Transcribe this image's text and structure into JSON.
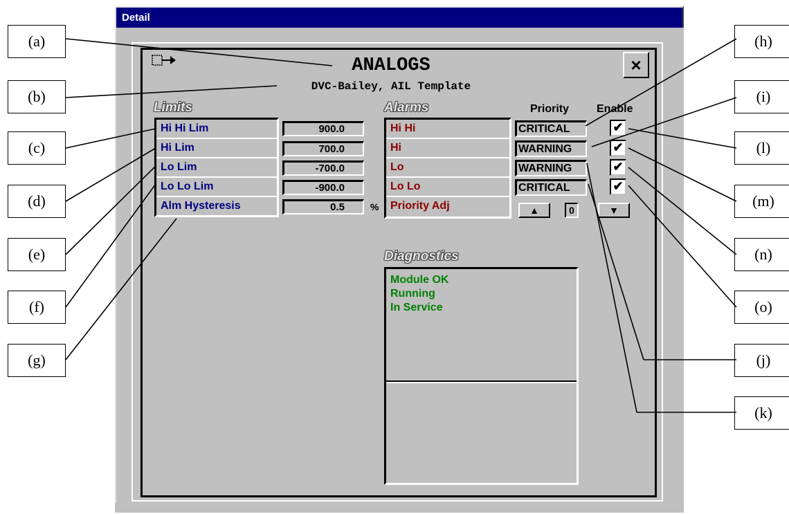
{
  "window": {
    "title": "Detail"
  },
  "header": {
    "title": "ANALOGS",
    "subtitle": "DVC-Bailey, AIL Template",
    "menu_icon": "menu-arrow-icon",
    "close_glyph": "×"
  },
  "limits": {
    "heading": "Limits",
    "rows": [
      {
        "label": "Hi Hi Lim",
        "value": "900.0"
      },
      {
        "label": "Hi Lim",
        "value": "700.0"
      },
      {
        "label": "Lo Lim",
        "value": "-700.0"
      },
      {
        "label": "Lo Lo Lim",
        "value": "-900.0"
      },
      {
        "label": "Alm Hysteresis",
        "value": "0.5"
      }
    ],
    "unit": "%"
  },
  "alarms": {
    "heading": "Alarms",
    "priority_header": "Priority",
    "enable_header": "Enable",
    "rows": [
      {
        "label": "Hi Hi",
        "priority": "CRITICAL",
        "enabled": "✔"
      },
      {
        "label": "Hi",
        "priority": "WARNING",
        "enabled": "✔"
      },
      {
        "label": "Lo",
        "priority": "WARNING",
        "enabled": "✔"
      },
      {
        "label": "Lo Lo",
        "priority": "CRITICAL",
        "enabled": "✔"
      }
    ],
    "priority_adj_label": "Priority Adj",
    "priority_adj_value": "0",
    "up_glyph": "▲",
    "down_glyph": "▼"
  },
  "diagnostics": {
    "heading": "Diagnostics",
    "lines": [
      "Module OK",
      "Running",
      "In Service"
    ]
  },
  "callouts": {
    "a": "(a)",
    "b": "(b)",
    "c": "(c)",
    "d": "(d)",
    "e": "(e)",
    "f": "(f)",
    "g": "(g)",
    "h": "(h)",
    "i": "(i)",
    "l": "(l)",
    "m": "(m)",
    "n": "(n)",
    "o": "(o)",
    "j": "(j)",
    "k": "(k)"
  },
  "colors": {
    "titlebar": "#000080",
    "face": "#c0c0c0",
    "limit_text": "#000080",
    "alarm_text": "#8b0000",
    "diag_text": "#008000"
  }
}
